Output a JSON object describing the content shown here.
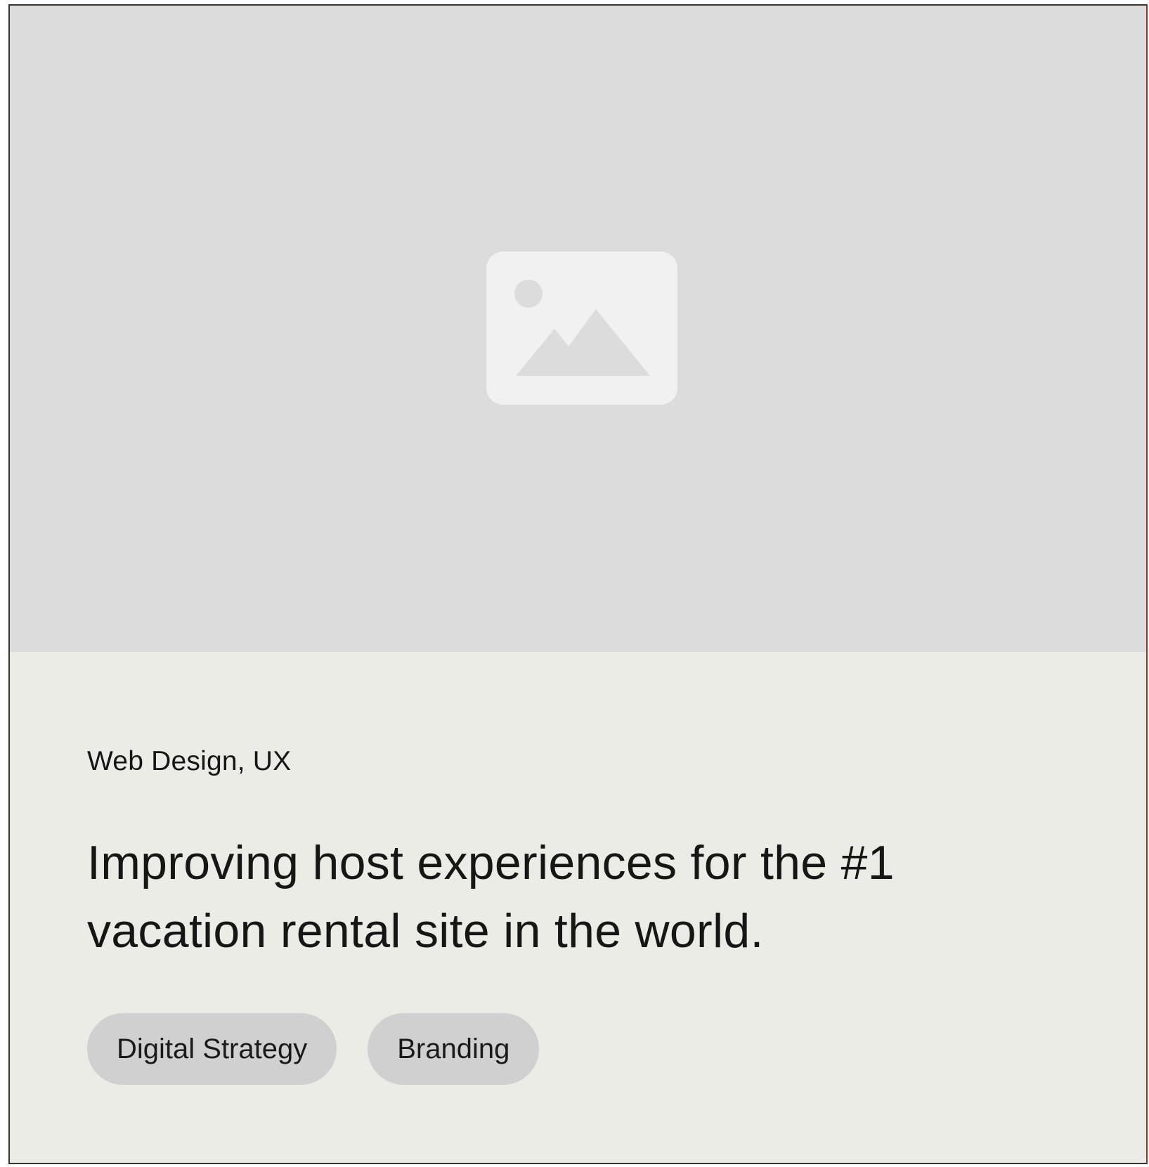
{
  "card": {
    "image": {
      "icon": "image-placeholder-icon"
    },
    "category": "Web Design, UX",
    "headline": "Improving host experiences for the #1 vacation rental site in the world.",
    "tags": [
      {
        "label": "Digital Strategy"
      },
      {
        "label": "Branding"
      }
    ]
  },
  "colors": {
    "image_background": "#dcdcdc",
    "icon_fill": "#f1f1f1",
    "card_background": "#ecece6",
    "tag_background": "#d0d0d0",
    "text": "#161616"
  }
}
